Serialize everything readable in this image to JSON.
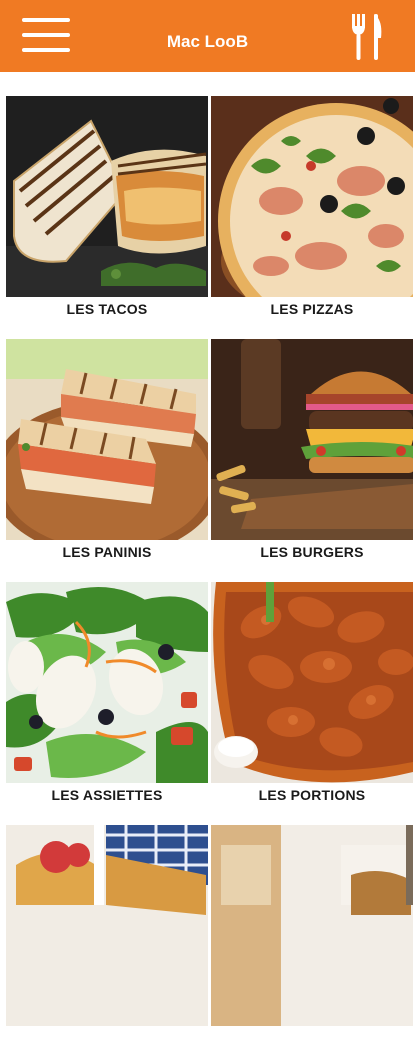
{
  "appbar": {
    "title": "Mac LooB",
    "menu_icon": "hamburger-menu-icon",
    "action_icon": "fork-knife-icon",
    "color": "#f07a23"
  },
  "categories": [
    {
      "label": "LES TACOS"
    },
    {
      "label": "LES PIZZAS"
    },
    {
      "label": "LES PANINIS"
    },
    {
      "label": "LES BURGERS"
    },
    {
      "label": "LES ASSIETTES"
    },
    {
      "label": "LES PORTIONS"
    },
    {
      "label": ""
    },
    {
      "label": ""
    }
  ]
}
